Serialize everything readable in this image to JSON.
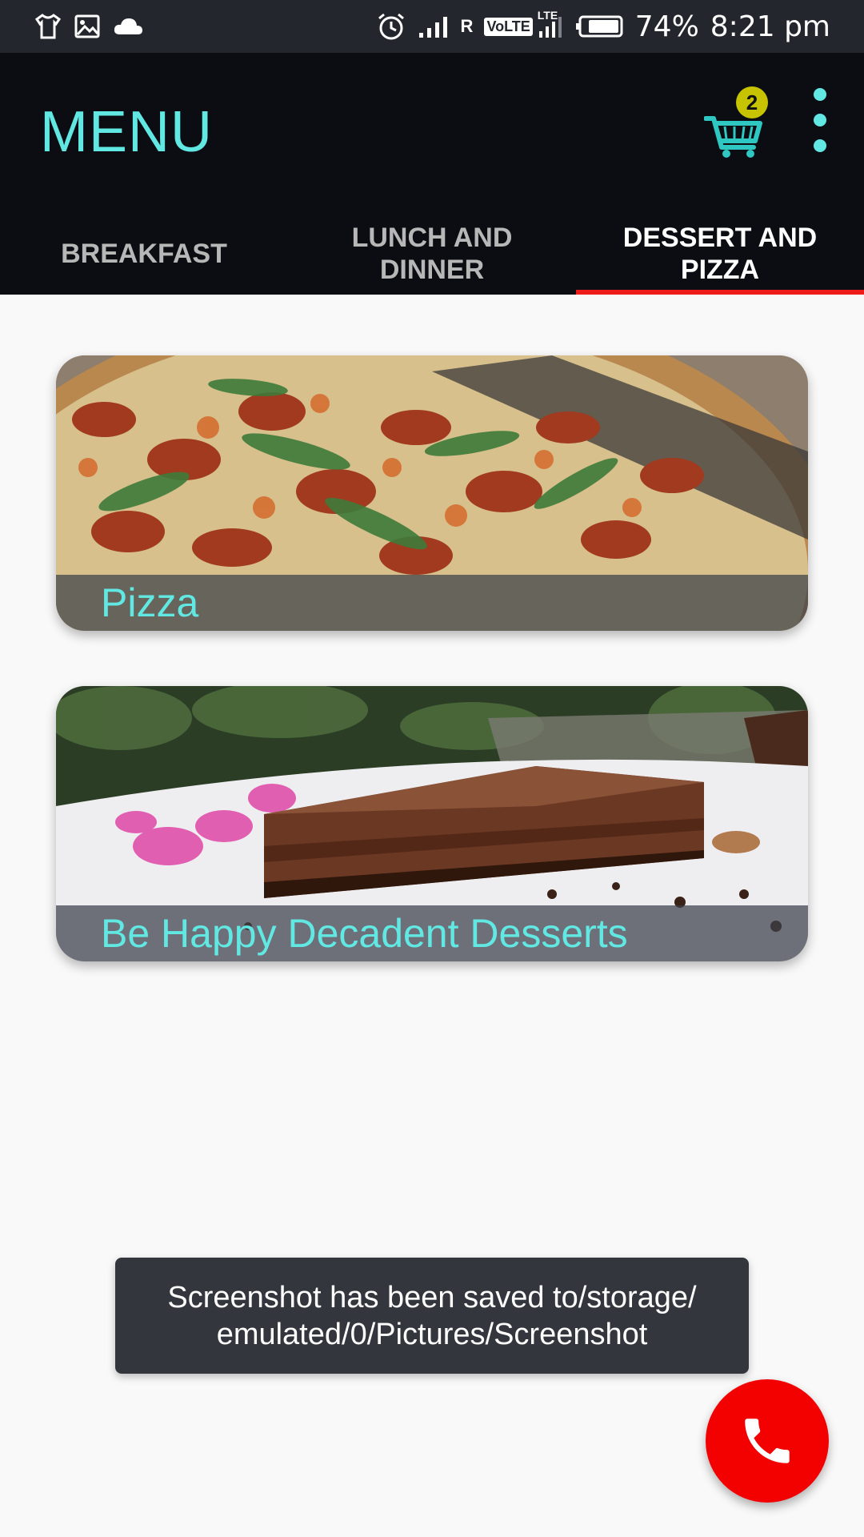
{
  "status_bar": {
    "battery": "74%",
    "time": "8:21 pm",
    "carrier_flag": "R",
    "volte": "VoLTE",
    "lte": "LTE",
    "icons": [
      "tshirt-icon",
      "image-icon",
      "cloud-icon",
      "alarm-icon",
      "signal-icon",
      "volte-signal-icon",
      "battery-icon"
    ]
  },
  "app_bar": {
    "title": "MENU",
    "cart_count": "2",
    "accent_color": "#62e8e3",
    "icons": [
      "cart-icon",
      "overflow-menu-icon"
    ]
  },
  "tabs": [
    {
      "label": "BREAKFAST",
      "selected": false
    },
    {
      "label": "LUNCH AND DINNER",
      "selected": false
    },
    {
      "label": "DESSERT AND PIZZA",
      "selected": true
    }
  ],
  "cards": [
    {
      "title": "Pizza"
    },
    {
      "title": "Be Happy Decadent Desserts"
    }
  ],
  "toast": {
    "message": "Screenshot has been saved to/storage/\nemulated/0/Pictures/Screenshot"
  },
  "fab": {
    "icon": "phone-icon",
    "color": "#f30000"
  }
}
